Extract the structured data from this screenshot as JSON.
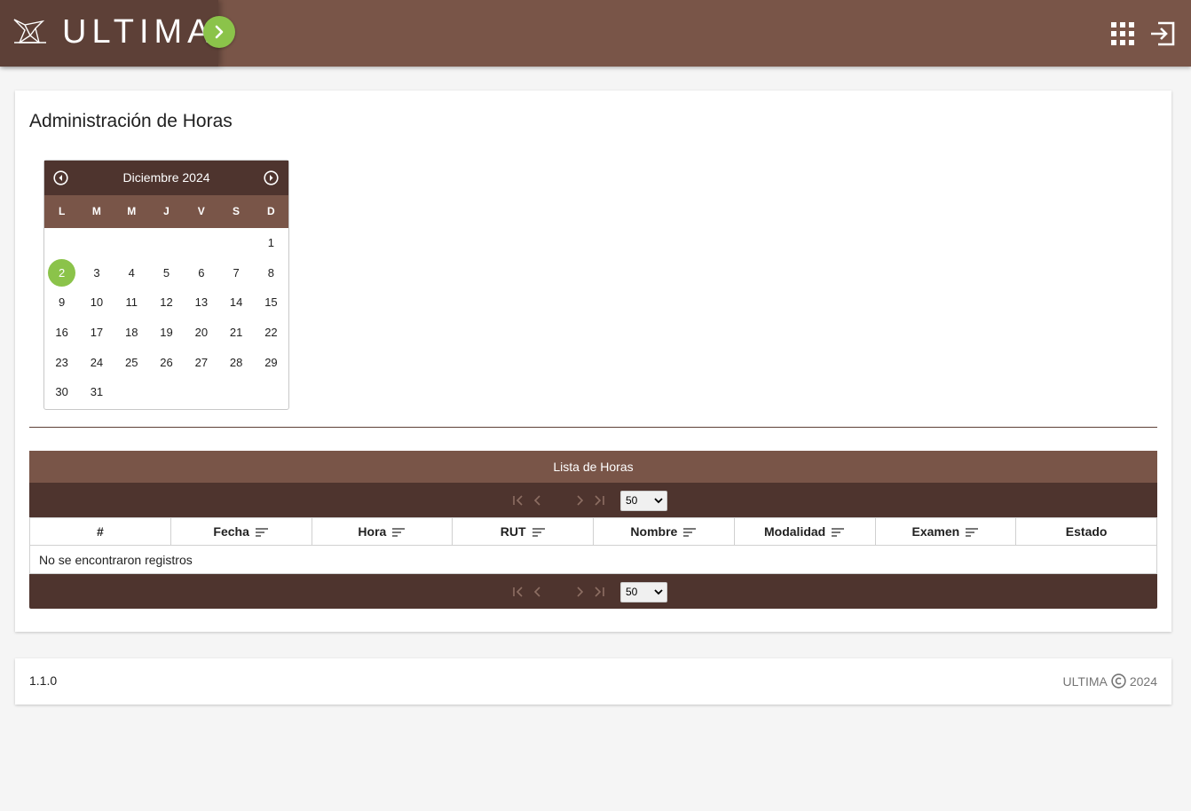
{
  "header": {
    "app_name": "ULTIMA",
    "logo_icon": "bird-logo-icon",
    "menu_icon": "chevron-right-icon",
    "apps_icon": "apps-grid-icon",
    "logout_icon": "logout-icon",
    "colors": {
      "topbar": "#795548",
      "logo_box": "#5d4037",
      "accent": "#8bc34a"
    }
  },
  "page": {
    "title": "Administración de Horas"
  },
  "calendar": {
    "month_label": "Diciembre 2024",
    "weekdays": [
      "L",
      "M",
      "M",
      "J",
      "V",
      "S",
      "D"
    ],
    "leading_blank_days": 6,
    "days": [
      "1",
      "2",
      "3",
      "4",
      "5",
      "6",
      "7",
      "8",
      "9",
      "10",
      "11",
      "12",
      "13",
      "14",
      "15",
      "16",
      "17",
      "18",
      "19",
      "20",
      "21",
      "22",
      "23",
      "24",
      "25",
      "26",
      "27",
      "28",
      "29",
      "30",
      "31"
    ],
    "selected_day": "2",
    "prev_icon": "circle-chevron-left-icon",
    "next_icon": "circle-chevron-right-icon"
  },
  "table": {
    "caption": "Lista de Horas",
    "columns": [
      "#",
      "Fecha",
      "Hora",
      "RUT",
      "Nombre",
      "Modalidad",
      "Examen",
      "Estado"
    ],
    "sortable": [
      false,
      true,
      true,
      true,
      true,
      true,
      true,
      false
    ],
    "empty_message": "No se encontraron registros",
    "rows_per_page": "50",
    "rows_per_page_options": [
      "50"
    ]
  },
  "footer": {
    "version": "1.1.0",
    "brand": "ULTIMA",
    "year": "2024",
    "copyright_icon": "copyright-icon"
  }
}
